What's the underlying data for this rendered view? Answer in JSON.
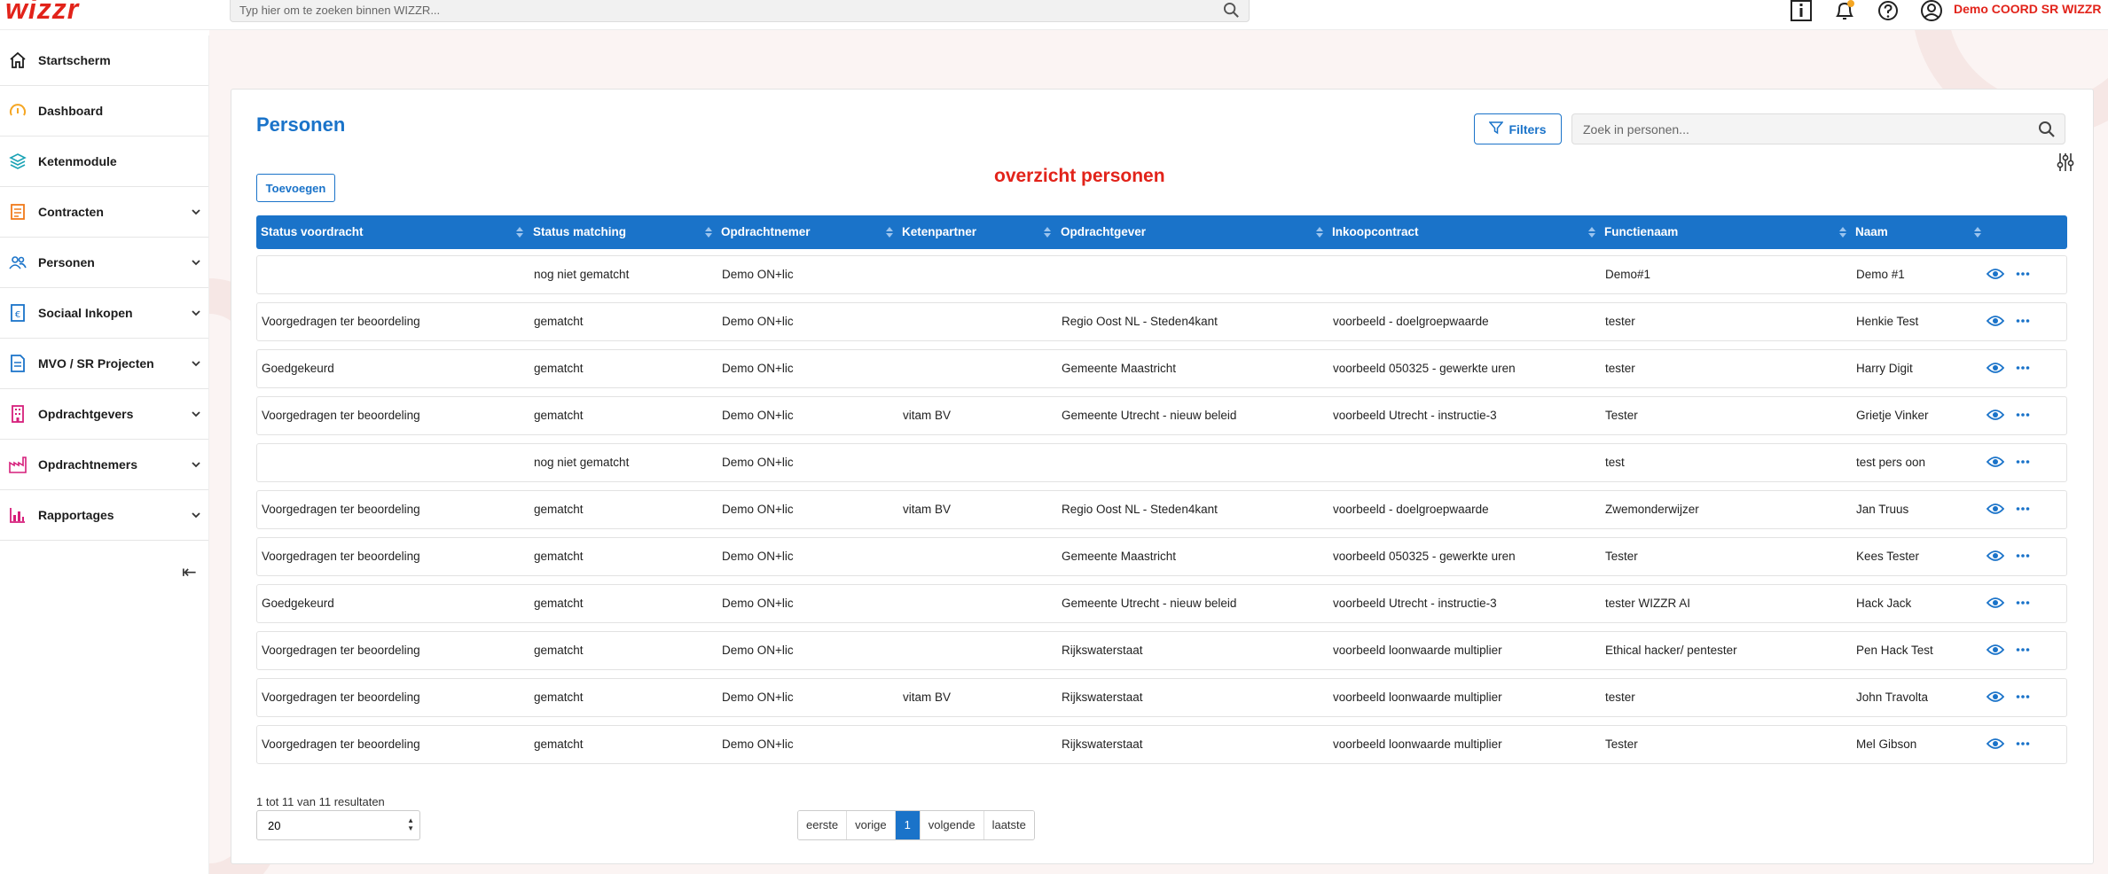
{
  "header": {
    "logo": "wizzr",
    "search_placeholder": "Typ hier om te zoeken binnen WIZZR...",
    "user_name": "Demo COORD SR WIZZR",
    "icons": [
      "info-icon",
      "bell-icon",
      "help-icon",
      "user-icon"
    ]
  },
  "sidebar": {
    "items": [
      {
        "label": "Startscherm",
        "icon": "home-icon",
        "color": "#1d1d1d",
        "expandable": false
      },
      {
        "label": "Dashboard",
        "icon": "gauge-icon",
        "color": "#f5a623",
        "expandable": false
      },
      {
        "label": "Ketenmodule",
        "icon": "layers-icon",
        "color": "#1aa3b5",
        "expandable": false
      },
      {
        "label": "Contracten",
        "icon": "contract-icon",
        "color": "#f07a1a",
        "expandable": true
      },
      {
        "label": "Personen",
        "icon": "people-icon",
        "color": "#1a73c9",
        "expandable": true
      },
      {
        "label": "Sociaal Inkopen",
        "icon": "document-euro-icon",
        "color": "#1a73c9",
        "expandable": true
      },
      {
        "label": "MVO / SR Projecten",
        "icon": "document-icon",
        "color": "#1a73c9",
        "expandable": true
      },
      {
        "label": "Opdrachtgevers",
        "icon": "building-icon",
        "color": "#d61f7b",
        "expandable": true
      },
      {
        "label": "Opdrachtnemers",
        "icon": "factory-icon",
        "color": "#d61f7b",
        "expandable": true
      },
      {
        "label": "Rapportages",
        "icon": "bar-chart-icon",
        "color": "#d61f7b",
        "expandable": true
      }
    ],
    "collapse_symbol": "⇤"
  },
  "main": {
    "title": "Personen",
    "filters_label": "Filters",
    "search_placeholder": "Zoek in personen...",
    "add_label": "Toevoegen",
    "annotation": "overzicht personen",
    "columns": [
      "Status voordracht",
      "Status matching",
      "Opdrachtnemer",
      "Ketenpartner",
      "Opdrachtgever",
      "Inkoopcontract",
      "Functienaam",
      "Naam"
    ],
    "rows": [
      [
        "",
        "nog niet gematcht",
        "Demo ON+lic",
        "",
        "",
        "",
        "Demo#1",
        "Demo #1"
      ],
      [
        "Voorgedragen ter beoordeling",
        "gematcht",
        "Demo ON+lic",
        "",
        "Regio Oost NL - Steden4kant",
        "voorbeeld - doelgroepwaarde",
        "tester",
        "Henkie Test"
      ],
      [
        "Goedgekeurd",
        "gematcht",
        "Demo ON+lic",
        "",
        "Gemeente Maastricht",
        "voorbeeld 050325 - gewerkte uren",
        "tester",
        "Harry Digit"
      ],
      [
        "Voorgedragen ter beoordeling",
        "gematcht",
        "Demo ON+lic",
        "vitam BV",
        "Gemeente Utrecht - nieuw beleid",
        "voorbeeld Utrecht - instructie-3",
        "Tester",
        "Grietje Vinker"
      ],
      [
        "",
        "nog niet gematcht",
        "Demo ON+lic",
        "",
        "",
        "",
        "test",
        "test pers oon"
      ],
      [
        "Voorgedragen ter beoordeling",
        "gematcht",
        "Demo ON+lic",
        "vitam BV",
        "Regio Oost NL - Steden4kant",
        "voorbeeld - doelgroepwaarde",
        "Zwemonderwijzer",
        "Jan Truus"
      ],
      [
        "Voorgedragen ter beoordeling",
        "gematcht",
        "Demo ON+lic",
        "",
        "Gemeente Maastricht",
        "voorbeeld 050325 - gewerkte uren",
        "Tester",
        "Kees Tester"
      ],
      [
        "Goedgekeurd",
        "gematcht",
        "Demo ON+lic",
        "",
        "Gemeente Utrecht - nieuw beleid",
        "voorbeeld Utrecht - instructie-3",
        "tester WIZZR AI",
        "Hack Jack"
      ],
      [
        "Voorgedragen ter beoordeling",
        "gematcht",
        "Demo ON+lic",
        "",
        "Rijkswaterstaat",
        "voorbeeld loonwaarde multiplier",
        "Ethical hacker/ pentester",
        "Pen Hack Test"
      ],
      [
        "Voorgedragen ter beoordeling",
        "gematcht",
        "Demo ON+lic",
        "vitam BV",
        "Rijkswaterstaat",
        "voorbeeld loonwaarde multiplier",
        "tester",
        "John Travolta"
      ],
      [
        "Voorgedragen ter beoordeling",
        "gematcht",
        "Demo ON+lic",
        "",
        "Rijkswaterstaat",
        "voorbeeld loonwaarde multiplier",
        "Tester",
        "Mel Gibson"
      ]
    ],
    "result_text": "1 tot 11 van 11 resultaten",
    "page_size": "20",
    "pager": {
      "first": "eerste",
      "prev": "vorige",
      "current": "1",
      "next": "volgende",
      "last": "laatste"
    }
  },
  "colors": {
    "accent": "#1a73c9",
    "brand": "#e2231a"
  }
}
